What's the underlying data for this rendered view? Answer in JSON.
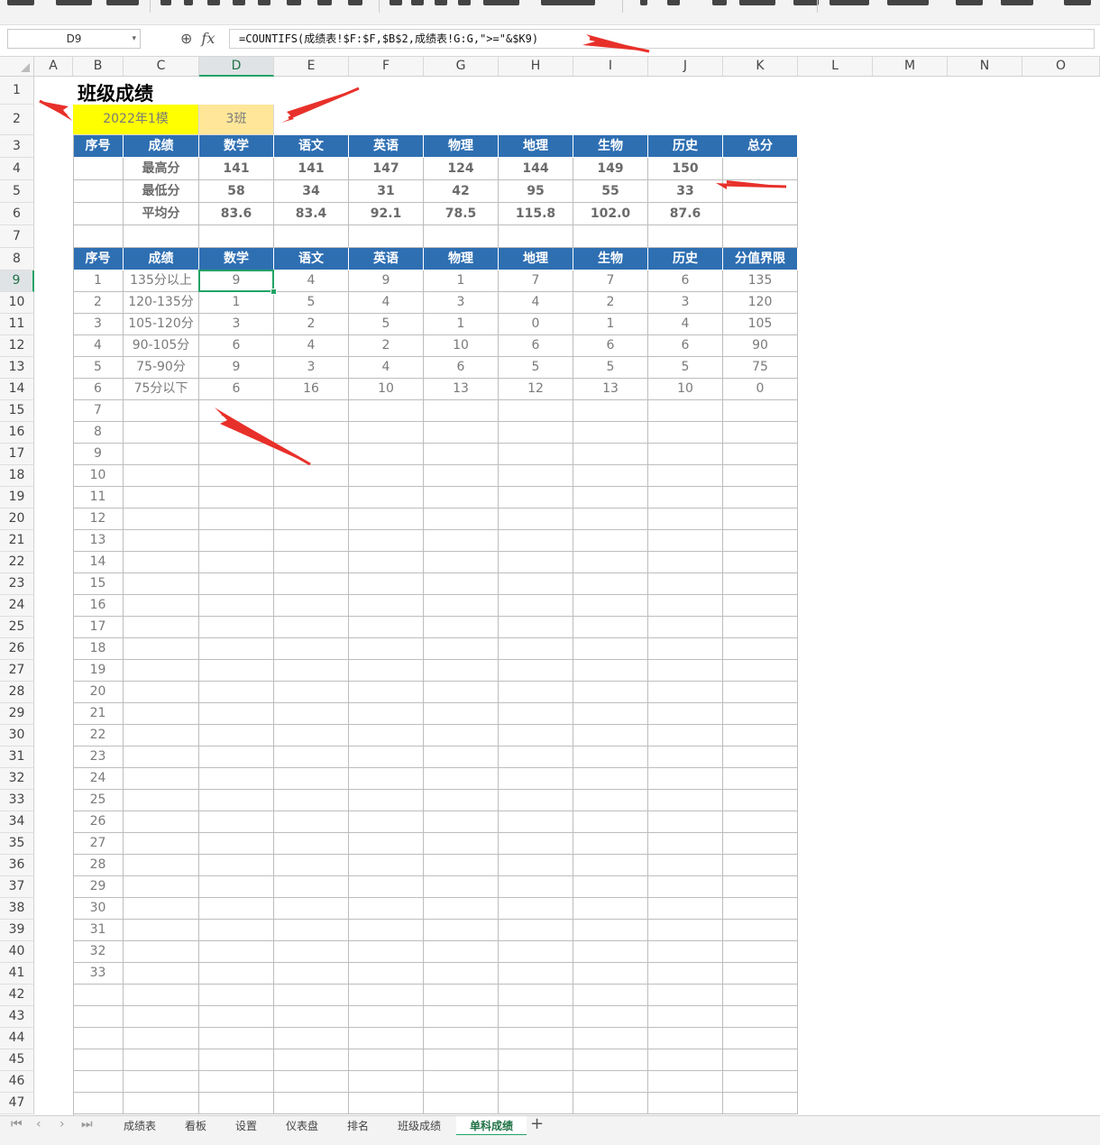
{
  "name_box": "D9",
  "formula_bar": {
    "zoom_icon": "zoom-icon",
    "fx_label": "fx",
    "formula": "=COUNTIFS(成绩表!$F:$F,$B$2,成绩表!G:G,\">=\"&$K9)"
  },
  "columns": [
    "A",
    "B",
    "C",
    "D",
    "E",
    "F",
    "G",
    "H",
    "I",
    "J",
    "K",
    "L",
    "M",
    "N",
    "O"
  ],
  "selected_column": "D",
  "selected_row": 9,
  "title": "班级成绩",
  "selectors": {
    "exam": "2022年1模",
    "class": "3班"
  },
  "table1": {
    "headers": [
      "序号",
      "成绩",
      "数学",
      "语文",
      "英语",
      "物理",
      "地理",
      "生物",
      "历史",
      "总分"
    ],
    "rows": [
      {
        "label": "最高分",
        "values": [
          "141",
          "141",
          "147",
          "124",
          "144",
          "149",
          "150",
          ""
        ]
      },
      {
        "label": "最低分",
        "values": [
          "58",
          "34",
          "31",
          "42",
          "95",
          "55",
          "33",
          ""
        ]
      },
      {
        "label": "平均分",
        "values": [
          "83.6",
          "83.4",
          "92.1",
          "78.5",
          "115.8",
          "102.0",
          "87.6",
          ""
        ]
      }
    ]
  },
  "table2": {
    "headers": [
      "序号",
      "成绩",
      "数学",
      "语文",
      "英语",
      "物理",
      "地理",
      "生物",
      "历史",
      "分值界限"
    ],
    "rows": [
      {
        "seq": "1",
        "label": "135分以上",
        "values": [
          "9",
          "4",
          "9",
          "1",
          "7",
          "7",
          "6",
          "135"
        ]
      },
      {
        "seq": "2",
        "label": "120-135分",
        "values": [
          "1",
          "5",
          "4",
          "3",
          "4",
          "2",
          "3",
          "120"
        ]
      },
      {
        "seq": "3",
        "label": "105-120分",
        "values": [
          "3",
          "2",
          "5",
          "1",
          "0",
          "1",
          "4",
          "105"
        ]
      },
      {
        "seq": "4",
        "label": "90-105分",
        "values": [
          "6",
          "4",
          "2",
          "10",
          "6",
          "6",
          "6",
          "90"
        ]
      },
      {
        "seq": "5",
        "label": "75-90分",
        "values": [
          "9",
          "3",
          "4",
          "6",
          "5",
          "5",
          "5",
          "75"
        ]
      },
      {
        "seq": "6",
        "label": "75分以下",
        "values": [
          "6",
          "16",
          "10",
          "13",
          "12",
          "13",
          "10",
          "0"
        ]
      }
    ],
    "extra_seq": [
      "7",
      "8",
      "9",
      "10",
      "11",
      "12",
      "13",
      "14",
      "15",
      "16",
      "17",
      "18",
      "19",
      "20",
      "21",
      "22",
      "23",
      "24",
      "25",
      "26",
      "27",
      "28",
      "29",
      "30",
      "31",
      "32",
      "33"
    ]
  },
  "sheet_tabs": [
    "成绩表",
    "看板",
    "设置",
    "仪表盘",
    "排名",
    "班级成绩",
    "单科成绩"
  ],
  "active_tab": "单科成绩",
  "colors": {
    "header_blue": "#2e6fb2",
    "exam_yellow": "#ffff00",
    "class_tan": "#ffe699",
    "accent_green": "#21a366",
    "arrow_red": "#e8302a"
  }
}
